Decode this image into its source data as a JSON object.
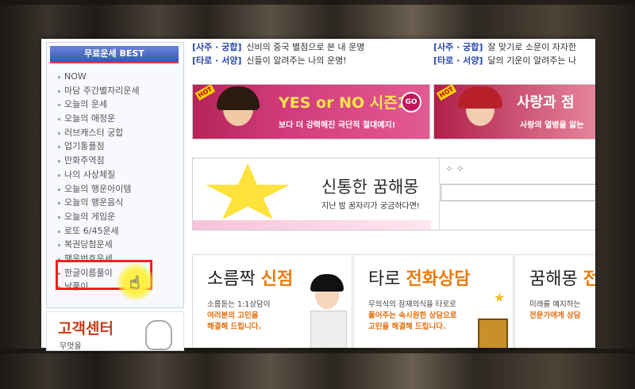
{
  "sidebar": {
    "title": "무료운세 BEST",
    "items": [
      "NOW",
      "마담 주간별자리운세",
      "오늘의 운세",
      "오늘의 애정운",
      "러브캐스터 궁합",
      "업기통플점",
      "만화주역점",
      "나의 사상체질",
      "오늘의 행운아이템",
      "오늘의 행운음식",
      "오늘의 게임운",
      "로또 6/45운세",
      "복권당첨운세",
      "행운번호운세",
      "한글이름풀이",
      "날풀이"
    ]
  },
  "customer_center": {
    "title": "고객센터",
    "sub": "무엇을"
  },
  "top_links": [
    {
      "cat": "[사주 · 궁합]",
      "text": "신비의 중국 별점으로 본 내 운명"
    },
    {
      "cat": "[타로 · 서양]",
      "text": "신들이 알려주는 나의 운명!"
    },
    {
      "cat": "[사주 · 궁합]",
      "text": "잘 맞기로 소문이 자자한"
    },
    {
      "cat": "[타로 · 서양]",
      "text": "달의 기운이 알려주는 나"
    }
  ],
  "banner1": {
    "hot": "HOT",
    "title": "YES or NO 시즌2",
    "go": "GO",
    "sub": "보다 더 강력해진 극단적 절대예지!"
  },
  "banner2": {
    "hot": "HOT",
    "title": "사랑과 점",
    "sub": "사랑의 열병을 앓는"
  },
  "dream": {
    "title": "신통한 꿈해몽",
    "sub": "지난 밤 꿈자리가 궁금하다면!"
  },
  "cards": [
    {
      "title_plain": "소름짝 ",
      "title_accent": "신점",
      "desc1": "소름돋는 1:1상담이",
      "desc2": "여러분의 고민을",
      "desc3": "해결해 드립니다."
    },
    {
      "title_plain": "타로 ",
      "title_accent": "전화상담",
      "desc1": "무의식의 잠재의식을 타로로",
      "desc2": "풀어주는 속시원한 상담으로",
      "desc3": "고민을 해결해 드립니다."
    },
    {
      "title_plain": "꿈해몽 ",
      "title_accent": "전",
      "desc1": "미래를 예지하는",
      "desc2": "전문가에게 상담",
      "desc3": ""
    }
  ],
  "colors": {
    "highlight_box": "#f02020",
    "sidebar_title_bg": "#3b56b8",
    "accent": "#e87b10"
  }
}
